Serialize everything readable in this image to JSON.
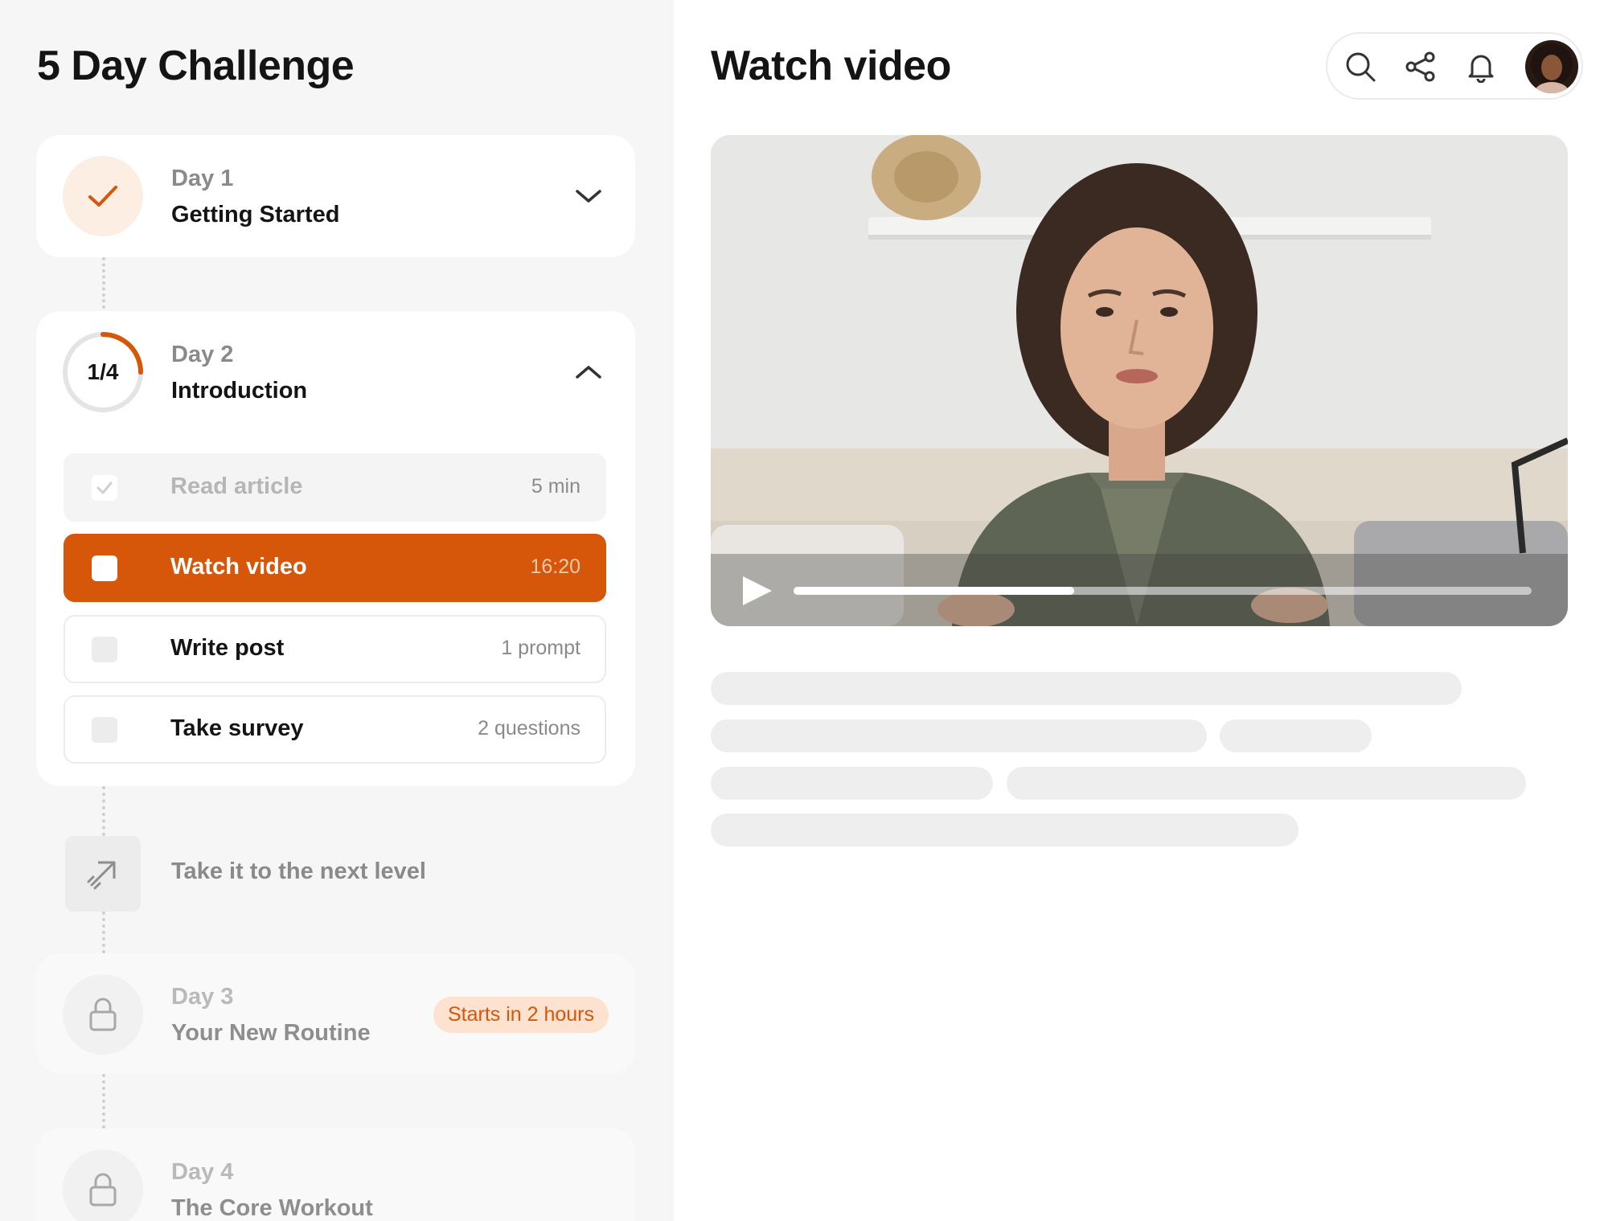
{
  "sidebar": {
    "title": "5 Day Challenge",
    "days": [
      {
        "label": "Day 1",
        "name": "Getting Started",
        "state": "completed"
      },
      {
        "label": "Day 2",
        "name": "Introduction",
        "state": "in-progress",
        "progress_text": "1/4",
        "progress_fraction": 0.25,
        "tasks": [
          {
            "name": "Read article",
            "meta": "5 min",
            "state": "completed"
          },
          {
            "name": "Watch video",
            "meta": "16:20",
            "state": "active"
          },
          {
            "name": "Write post",
            "meta": "1 prompt",
            "state": "todo"
          },
          {
            "name": "Take survey",
            "meta": "2 questions",
            "state": "todo"
          }
        ]
      },
      {
        "label": "Day 3",
        "name": "Your New Routine",
        "state": "locked",
        "badge": "Starts in 2 hours"
      },
      {
        "label": "Day 4",
        "name": "The Core Workout",
        "state": "locked"
      }
    ],
    "next_level": {
      "label": "Take it to the next level",
      "icon": "arrow-up-right-icon"
    }
  },
  "main": {
    "title": "Watch video",
    "toolbar": {
      "icons": [
        "search-icon",
        "share-icon",
        "bell-icon"
      ],
      "avatar": "user-avatar"
    },
    "video": {
      "progress_fraction": 0.38,
      "play_icon": "play-icon"
    }
  },
  "colors": {
    "accent": "#d6560a",
    "accent_soft": "#fde2d0",
    "sidebar_bg": "#f6f6f6",
    "skeleton": "#eeeeee"
  }
}
